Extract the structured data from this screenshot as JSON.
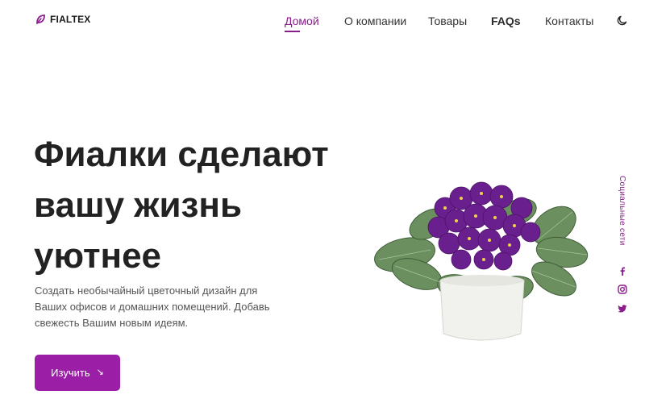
{
  "brand": {
    "name": "FIALTEX",
    "logo_icon": "leaf-icon",
    "accent": "#8a1d8c"
  },
  "nav": {
    "items": [
      {
        "label": "Домой",
        "active": true
      },
      {
        "label": "О компании",
        "active": false
      },
      {
        "label": "Товары",
        "active": false
      },
      {
        "label": "FAQs",
        "active": false
      },
      {
        "label": "Контакты",
        "active": false
      }
    ],
    "theme_icon": "moon-icon"
  },
  "hero": {
    "title_lines": [
      "Фиалки сделают",
      "вашу жизнь",
      "уютнее"
    ],
    "subtitle_lines": [
      "Создать необычайный цветочный дизайн для",
      "Ваших офисов и домашних помещений. Добавь",
      "свежесть Вашим новым идеям."
    ],
    "cta_label": "Изучить",
    "cta_icon": "arrow-down-right-icon",
    "cta_color": "#9b1fa6",
    "image": "potted-violet-image"
  },
  "social": {
    "label": "Социальные сети",
    "items": [
      {
        "icon": "facebook-icon"
      },
      {
        "icon": "instagram-icon"
      },
      {
        "icon": "twitter-icon"
      }
    ]
  }
}
